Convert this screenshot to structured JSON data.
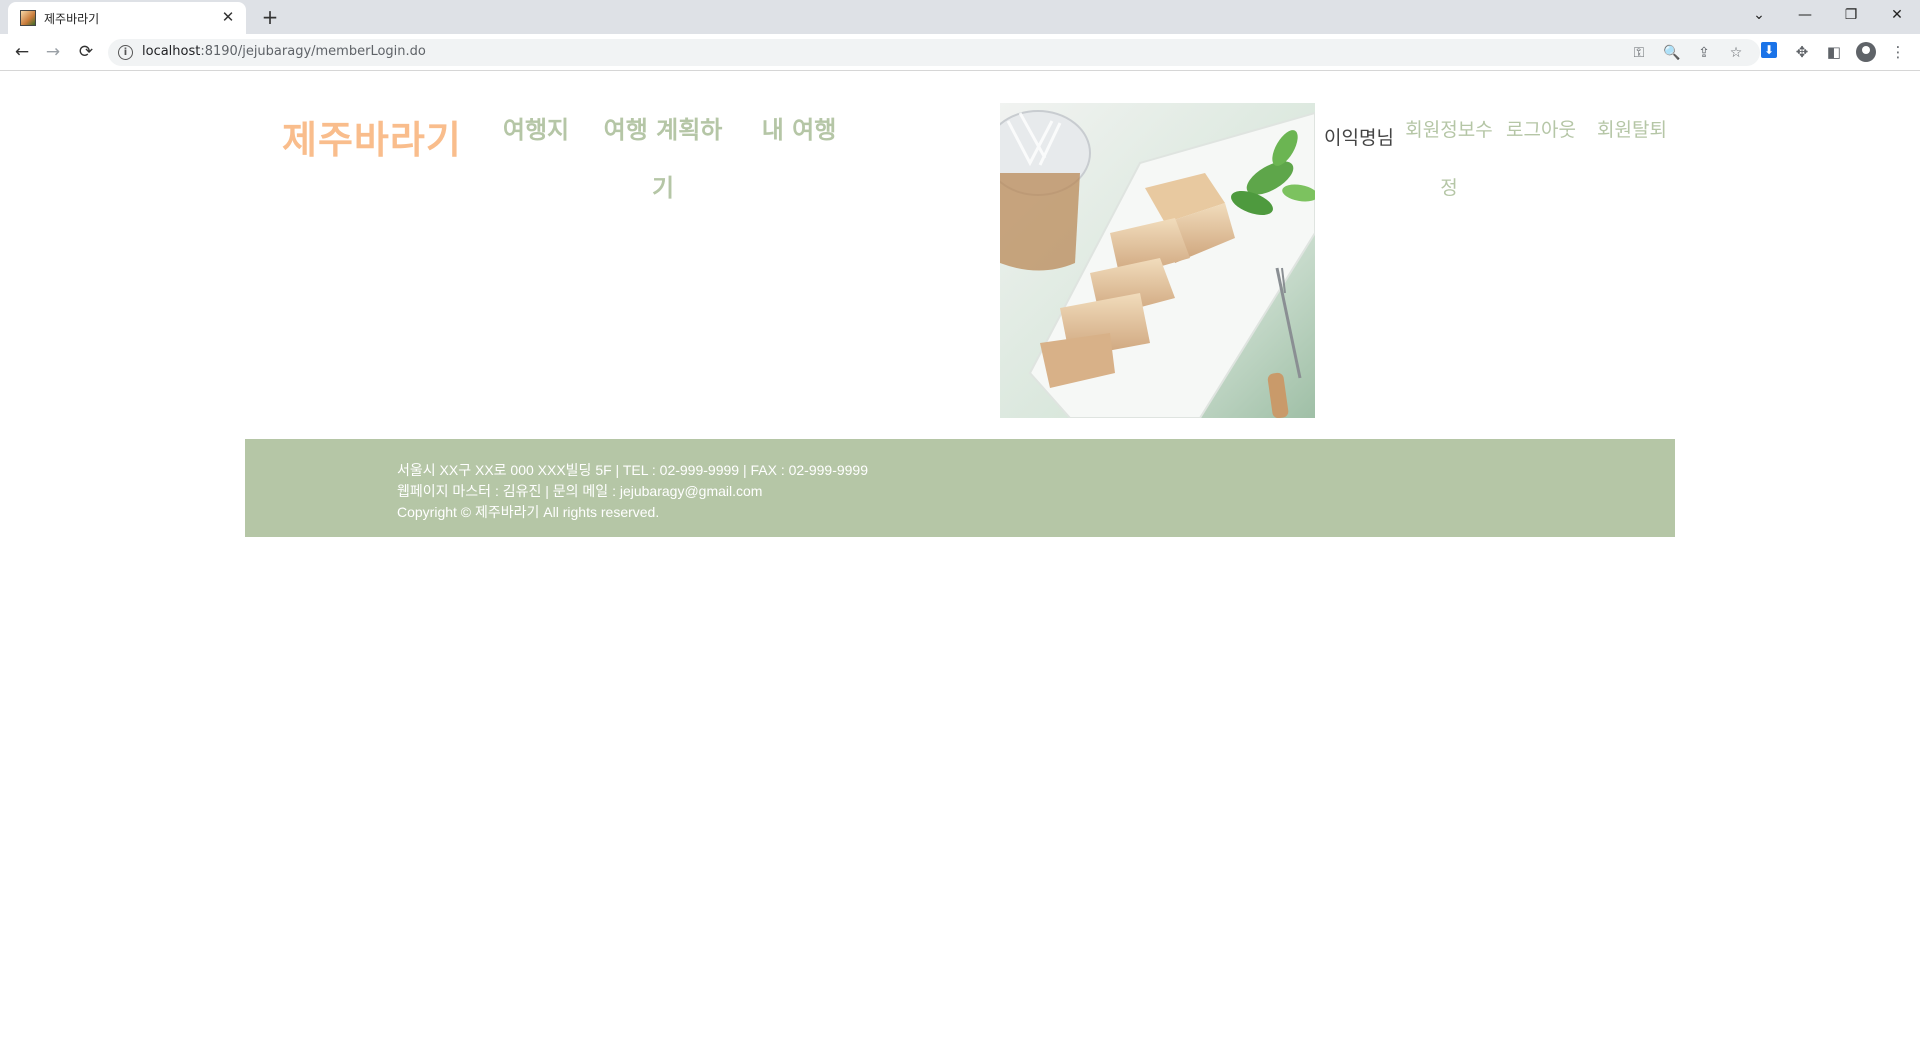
{
  "browser": {
    "tab": {
      "title": "제주바라기",
      "favicon": "site-favicon-icon"
    },
    "url": {
      "host": "localhost",
      "path": ":8190/jejubaragy/memberLogin.do"
    },
    "icons": {
      "back": "←",
      "forward": "→",
      "reload": "⟳",
      "new_tab": "+",
      "close_tab": "✕",
      "key": "⚿",
      "zoom": "🔍",
      "share": "⇪",
      "star": "☆",
      "puzzle": "✥",
      "sidebar": "◧",
      "menu": "⋮",
      "chevron": "⌄",
      "minimize": "—",
      "restore": "❐",
      "close": "✕"
    }
  },
  "header": {
    "logo": "제주바라기",
    "menu": [
      "여행지",
      "여행 계획하기",
      "내 여행"
    ],
    "user": {
      "greeting": "이익명님",
      "links": [
        "회원정보수정",
        "로그아웃",
        "회원탈퇴"
      ]
    }
  },
  "footer": {
    "address": "서울시 XX구 XX로 000 XXX빌딩 5F | TEL : 02-999-9999 | FAX : 02-999-9999",
    "contact": "웹페이지 마스터 : 김유진 | 문의 메일 : jejubaragy@gmail.com",
    "copyright": "Copyright © 제주바라기 All rights reserved."
  },
  "colors": {
    "logo": "#f9bd8c",
    "menu": "#b5c6a6",
    "footer_bg": "#b5c6a6"
  }
}
